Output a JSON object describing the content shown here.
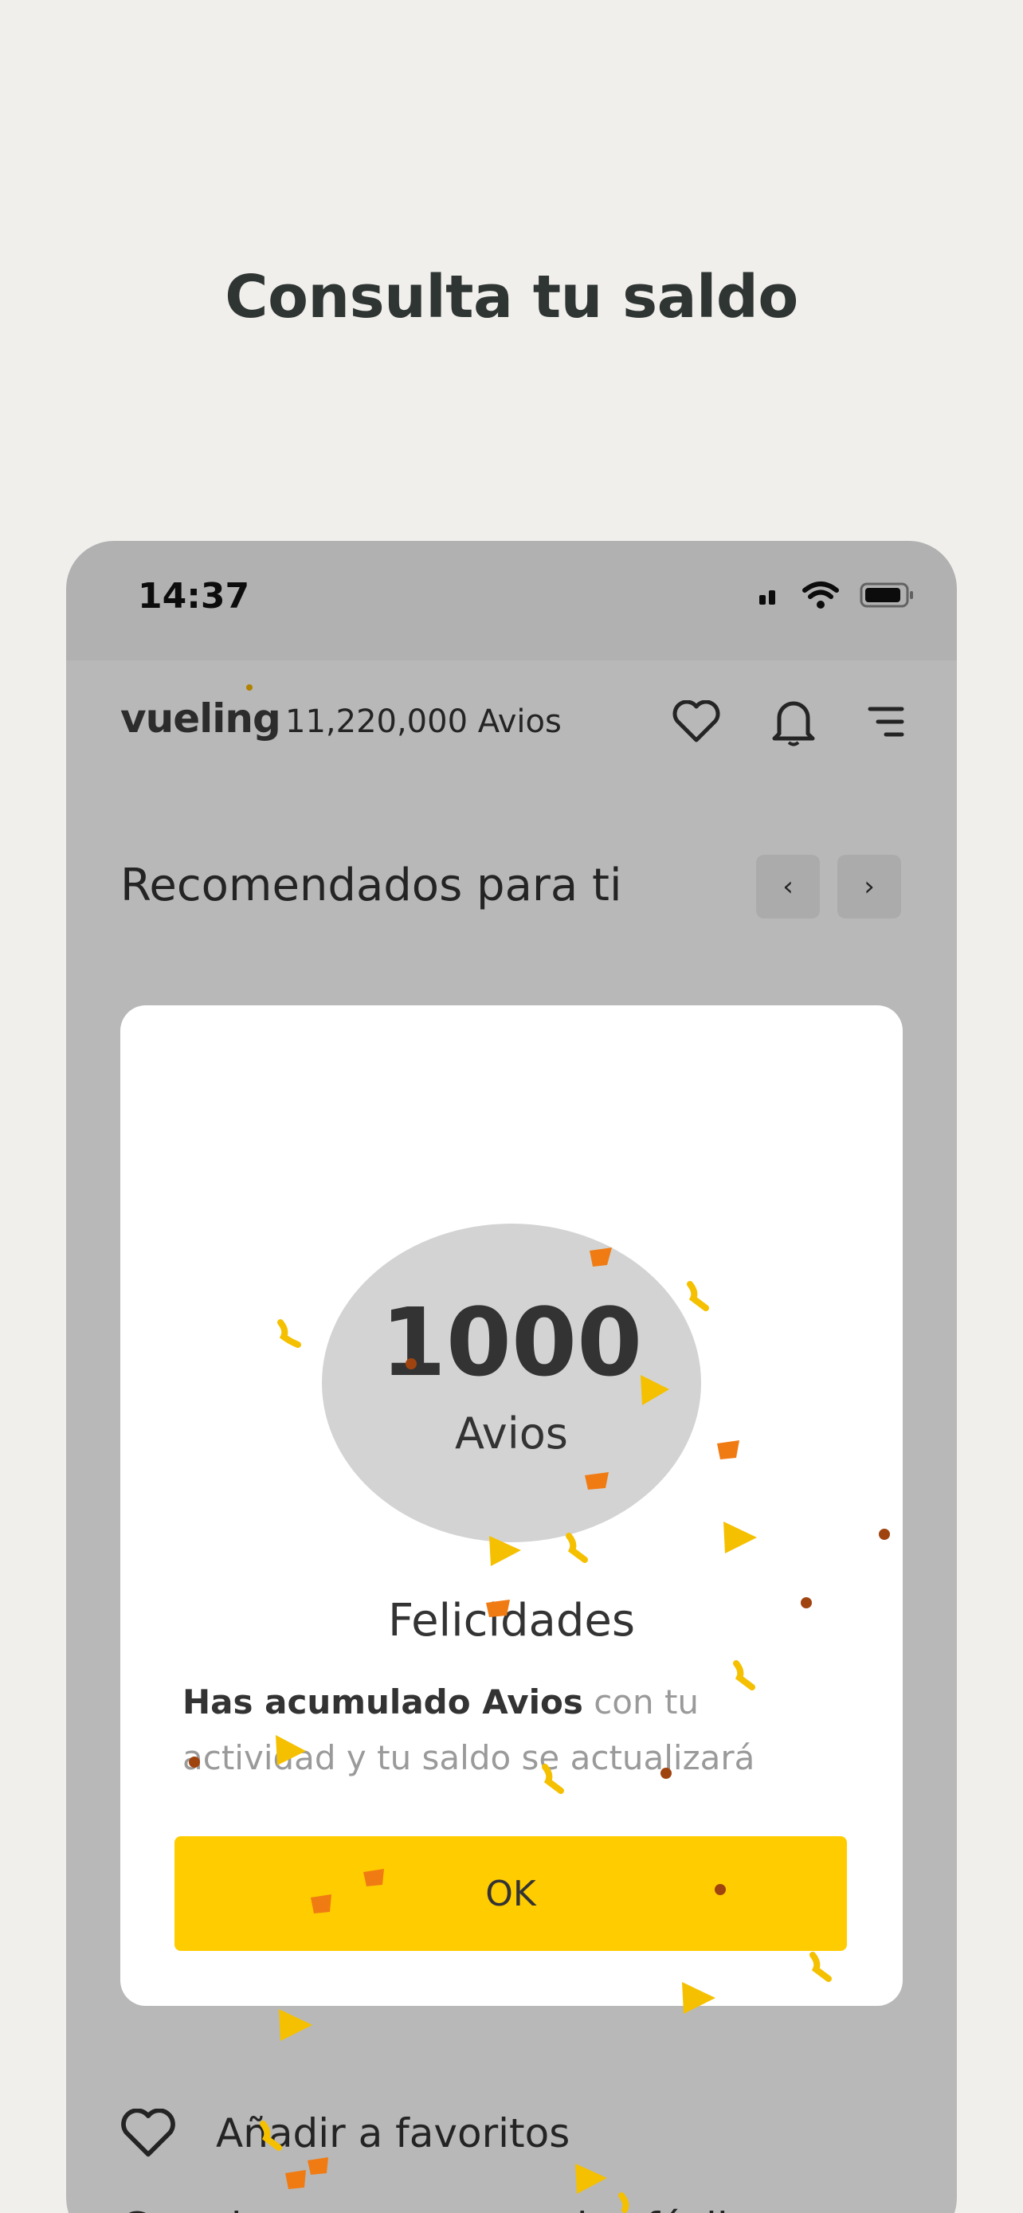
{
  "headline": "Consulta tu saldo",
  "status_bar": {
    "time": "14:37"
  },
  "app_bar": {
    "logo_text": "vueling",
    "balance": "11,220,000 Avios"
  },
  "recommendations": {
    "title": "Recomendados para ti",
    "prev_label": "‹",
    "next_label": "›"
  },
  "favorites": {
    "label": "Añadir a favoritos",
    "cut_text": "Guarda y compara vuelos fácilmente cuando quieras"
  },
  "modal": {
    "points": "1000",
    "unit": "Avios",
    "title": "Felicidades",
    "body_bold": "Has acumulado Avios",
    "body_rest": " con tu actividad y tu saldo se actualizará",
    "ok_label": "OK"
  },
  "colors": {
    "accent": "#ffcc00",
    "background": "#f0efec",
    "confetti": [
      "#ffcc00",
      "#f07b13",
      "#a0440f"
    ]
  }
}
